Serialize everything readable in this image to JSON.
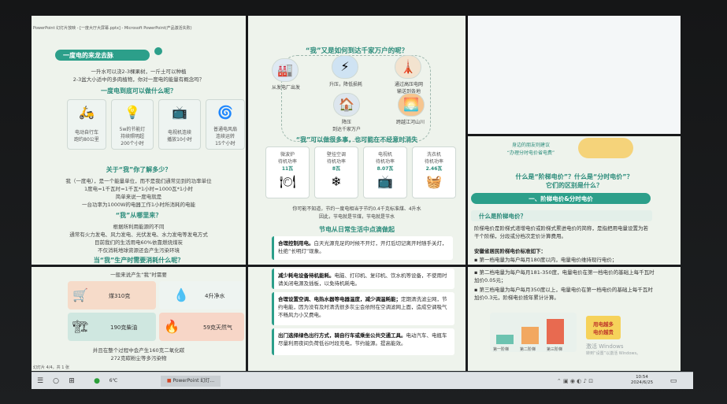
{
  "window_title": "PowerPoint 幻灯片放映 - [一度大厅大屏幕.pptx] - Microsoft PowerPoint(产品激活失败)",
  "slide1": {
    "title": "一度电的来龙去脉",
    "intro_1": "一升水可以浇2-3棵果树，一斤土可以种植",
    "intro_2": "2-3盆大小适中的多肉植物，你对一度电的能量有概念吗？",
    "q1": "一度电到底可以做什么呢？",
    "uses": [
      {
        "label": "电动自行车\n跑约80公里",
        "icon": "scooter-icon"
      },
      {
        "label": "5w的节能灯\n持续照明超\n200个小时",
        "icon": "lamp-icon"
      },
      {
        "label": "电视机连续\n播放10小时",
        "icon": "tv-icon"
      },
      {
        "label": "普通电风扇\n连续运转\n15个小时",
        "icon": "fan-icon"
      }
    ],
    "q2": "关于“我”你了解多少？",
    "about": [
      "我（一度电），是一个能量单位，而不是我们通常见到的功率单位",
      "1度电=1千瓦时=1千瓦*1小时=1000瓦*1小时",
      "简单来说一度电就是",
      "一台功率为1000W的电器工作1小时所消耗的电能"
    ],
    "q3": "“我”从哪里来？",
    "source": [
      "根据所利用能源的不同",
      "通常有火力发电、风力发电、光伏发电、水力发电等发电方式",
      "目前我们的生活用电60%依靠燃烧煤炭",
      "不仅消耗地球资源还会产生污染环境"
    ],
    "q4": "当“我”生产时需要消耗什么呢？",
    "consume_intro": "一般来说产生“我”时需要",
    "resources": [
      {
        "label": "煤310克",
        "icon": "coal-cart-icon",
        "color": "#f6dbc9"
      },
      {
        "label": "4升净水",
        "icon": "water-drop-icon",
        "color": "#eef4f1"
      },
      {
        "label": "190克柴油",
        "icon": "oil-rig-icon",
        "color": "#cfe7e0"
      },
      {
        "label": "59克天然气",
        "icon": "gas-flame-icon",
        "color": "#f7d6c7"
      }
    ],
    "outro_1": "并且在整个过程中会产生160克二氧化碳",
    "outro_2": "272克碳粉尘等多污染物",
    "status": "幻灯片 4/4，共 1 张"
  },
  "slide2": {
    "title": "“我”又是如何到达千家万户的呢？",
    "flow": [
      {
        "label": "从发电厂出发",
        "icon": "power-plant-icon"
      },
      {
        "label": "升压，降低损耗",
        "icon": "transformer-icon"
      },
      {
        "label": "通过高压电网\n输送到各地",
        "icon": "power-tower-icon"
      },
      {
        "label": "降压\n到达千家万户",
        "icon": "household-icon"
      },
      {
        "label": "跨越江河山川",
        "icon": "river-sunset-icon"
      }
    ],
    "q1": "“我”可以做很多事，也可能在不经意时消失",
    "standby": [
      {
        "label": "微波炉\n待机功率",
        "value": "11瓦"
      },
      {
        "label": "壁挂空调\n待机功率",
        "value": "8瓦"
      },
      {
        "label": "电视机\n待机功率",
        "value": "8.07瓦"
      },
      {
        "label": "洗衣机\n待机功率",
        "value": "2.46瓦"
      }
    ],
    "standby_note_1": "你可能不知道，节约一度电相当于节约0.4千克标准煤、4升水",
    "standby_note_2": "因此，节电就是节煤，节电就是节水",
    "q2": "节电从日常生活中点滴做起",
    "tips": [
      {
        "head": "合理控制用电。",
        "text": "白天光源充足的时候不开灯，开灯后切记离开时随手关灯，杜绝“长明灯”现象。"
      },
      {
        "head": "减少耗电设备待机能耗。",
        "text": "电脑、打印机、复印机、饮水机等设备，不使用时请关闭电源及插板，以免待机耗电。"
      },
      {
        "head": "合理设置空调、电热水器等电器温度，减少调温耗能；",
        "text": "定期清洗滤尘网，节约电能，因为没有及时清洗很多灰尘会依附在空调滤网上面，造成空调吸气不畅风力小又费电。"
      },
      {
        "head": "出门选择绿色出行方式，骑自行车或乘坐公共交通工具。",
        "text": "电动汽车、电瓶车尽量利用夜间负荷低谷时段充电，节约能源。提高能效。"
      }
    ]
  },
  "slide3": {
    "caption_1": "身边的朋友则建议",
    "caption_2": "“办理分时电价省电费”",
    "q1": "什么是“阶梯电价”？什么是“分时电价”？",
    "q1b": "它们的区别是什么？",
    "section": "一、阶梯电价&分时电价",
    "q2": "什么是阶梯电价？",
    "desc": "阶梯电价是阶梯式递增电价或阶梯式累进电价的简称，是指把用电量设置为若干个阶梯，分段或分档次定价计算费用。",
    "standard_title": "安徽省居民阶梯电价标准如下：",
    "tiers": [
      {
        "text": "第一档电量为每户每月180度以内，电量电价维持现行电价；",
        "color": "#2c9f8a"
      },
      {
        "text": "第二档电量为每户每月181-350度，电量电价在第一档电价的基础上每千瓦时加价0.05元；",
        "color": "#e0912f"
      },
      {
        "text": "第三档电量为每户每月350度以上，电量电价在第一档电价的基础上每千瓦时加价0.3元，阶梯电价按年累计计算。",
        "color": "#d94c3a"
      }
    ],
    "bars": [
      {
        "label": "第一阶梯",
        "value": 1
      },
      {
        "label": "第二阶梯",
        "value": 2
      },
      {
        "label": "第三阶梯",
        "value": 3
      }
    ],
    "badge_1": "用电越多",
    "badge_2": "电价越贵",
    "watermark_1": "激活 Windows",
    "watermark_2": "转到“设置”以激活 Windows。"
  },
  "taskbar": {
    "app_label": "PowerPoint 幻灯...",
    "weather": "6℃",
    "time": "10:54",
    "date": "2024/6/25"
  }
}
